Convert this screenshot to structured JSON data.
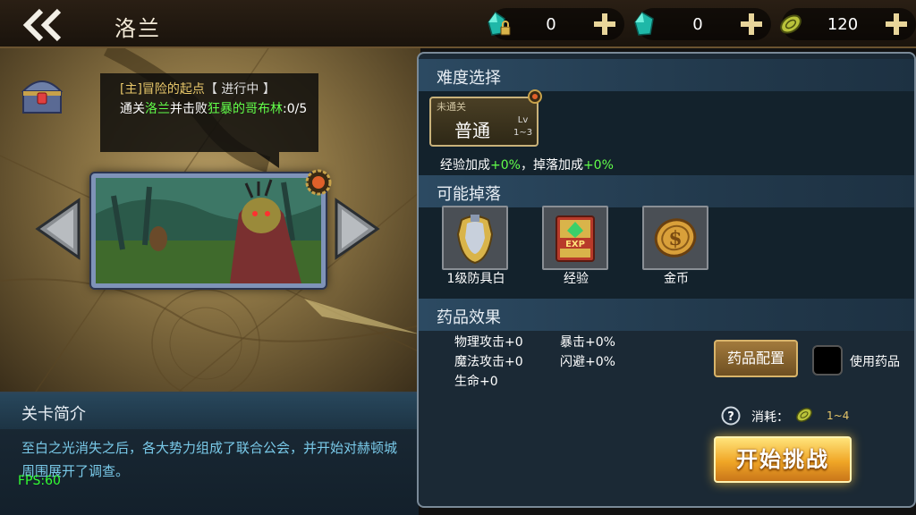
{
  "header": {
    "title": "洛兰",
    "resources": [
      {
        "icon": "locked-diamond-icon",
        "value": "0"
      },
      {
        "icon": "diamond-icon",
        "value": "0"
      },
      {
        "icon": "coin-icon",
        "value": "120"
      }
    ]
  },
  "quest": {
    "title_prefix": "[主]冒险的起点",
    "title_status": "【 进行中 】",
    "body_1": "通关",
    "body_place": "洛兰",
    "body_2": "并击败",
    "body_enemy": "狂暴的哥布林",
    "body_progress": ":0/5"
  },
  "intro": {
    "heading": "关卡简介",
    "text": "至白之光消失之后，各大势力组成了联合公会，并开始对赫顿城周围展开了调查。"
  },
  "fps": "FPS:60",
  "difficulty": {
    "heading": "难度选择",
    "status": "未通关",
    "name": "普通",
    "lv_label": "Lv",
    "lv_range": "1~3",
    "exp_label": "经验加成",
    "exp_value": "+0%",
    "sep": "，",
    "drop_label": "掉落加成",
    "drop_value": "+0%"
  },
  "drops": {
    "heading": "可能掉落",
    "items": [
      {
        "icon": "armor-icon",
        "label": "1级防具白"
      },
      {
        "icon": "exp-book-icon",
        "label": "经验"
      },
      {
        "icon": "gold-coin-icon",
        "label": "金币"
      }
    ]
  },
  "potion": {
    "heading": "药品效果",
    "phys_atk": "物理攻击+0",
    "mag_atk": "魔法攻击+0",
    "hp": "生命+0",
    "crit": "暴击+0%",
    "dodge": "闪避+0%",
    "config_button": "药品配置",
    "use_label": "使用药品"
  },
  "cost": {
    "label": "消耗：",
    "value": "1~4"
  },
  "start_button": "开始挑战"
}
